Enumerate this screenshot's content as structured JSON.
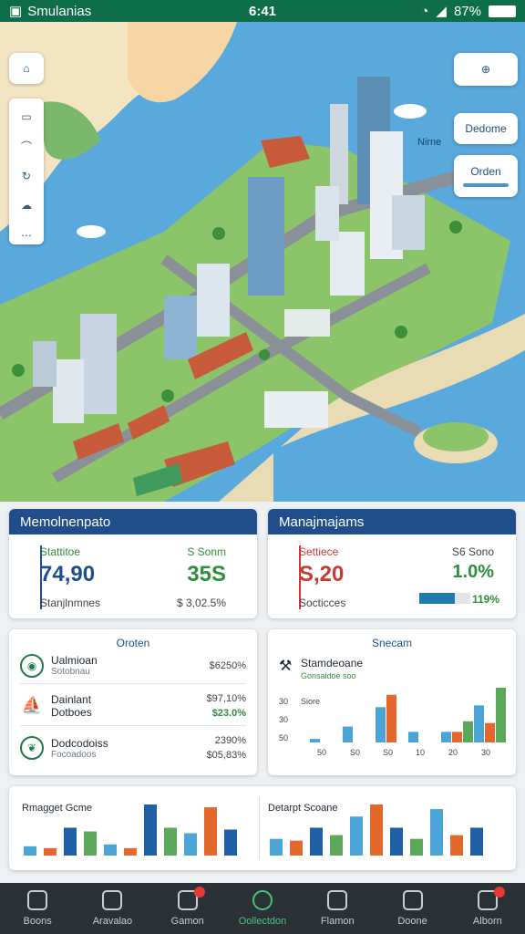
{
  "status_bar": {
    "app_name": "Smulanias",
    "time": "6:41",
    "battery": "87%"
  },
  "map": {
    "controls": {
      "compass": "compass",
      "doneme_label": "Dedome",
      "zoom_label": "Orden"
    },
    "side_label": "Nirne",
    "toolbar_items": [
      "layers-icon",
      "route-icon",
      "refresh-icon",
      "cloud-icon",
      "more-icon"
    ]
  },
  "panel_left": {
    "title": "Memolnenpato",
    "stat_label": "Stattitoe",
    "stat_value": "74,90",
    "right_label": "S Sonm",
    "right_value": "35S",
    "footer_label": "Stanjlnmnes",
    "footer_value": "$ 3,02.5%"
  },
  "panel_right": {
    "title": "Manajmajams",
    "stat_label": "Settiece",
    "stat_value": "S,20",
    "right_label": "S6 Sono",
    "right_value": "1.0%",
    "footer_label": "Socticces",
    "footer_value": "119%",
    "progress": 0.7
  },
  "list_panel": {
    "title": "Oroten",
    "rows": [
      {
        "name": "Ualmioan",
        "sub": "Sotobnau",
        "v1": "$6250%",
        "v2": ""
      },
      {
        "name": "Dainlant\nDotboes",
        "sub": "",
        "v1": "$97,10%",
        "v2": "$23.0%"
      },
      {
        "name": "Dodcodoiss",
        "sub": "Focoadoos",
        "v1": "2390%",
        "v2": "$05,83%"
      }
    ]
  },
  "chart_panel": {
    "title": "Snecam",
    "legend_title": "Stamdeoane",
    "legend_sub": "Gonsaidoe soo",
    "legend_name": "Siore",
    "chart_data": {
      "type": "bar",
      "categories": [
        "50",
        "S0",
        "S0",
        "10",
        "20",
        "30"
      ],
      "series": [
        {
          "name": "",
          "values": [
            2,
            9,
            20,
            6,
            6,
            21
          ]
        },
        {
          "name": "",
          "values": [
            0,
            0,
            27,
            0,
            6,
            11
          ]
        },
        {
          "name": "",
          "values": [
            0,
            0,
            0,
            0,
            12,
            31
          ]
        }
      ],
      "ylabel_ticks": [
        "30",
        "30",
        "50"
      ],
      "colors": [
        "#4aa5d6",
        "#e2682e",
        "#5ba85a"
      ]
    }
  },
  "bottom_panel": {
    "left_title": "Rmagget Gcme",
    "right_title": "Detarpt Scoane",
    "left_chart": {
      "type": "bar",
      "values": [
        10,
        8,
        30,
        26,
        12,
        8,
        55,
        30,
        24,
        52,
        28
      ]
    },
    "right_chart": {
      "type": "bar",
      "values": [
        18,
        16,
        30,
        22,
        42,
        55,
        30,
        18,
        50,
        22,
        30
      ]
    }
  },
  "nav": [
    {
      "label": "Boons",
      "badge": false
    },
    {
      "label": "Aravalao",
      "badge": false
    },
    {
      "label": "Gamon",
      "badge": true
    },
    {
      "label": "Oollectdon",
      "badge": false
    },
    {
      "label": "Flamon",
      "badge": false
    },
    {
      "label": "Doone",
      "badge": false
    },
    {
      "label": "Alborn",
      "badge": true
    }
  ],
  "colors": {
    "primary": "#1f4e8a",
    "accent": "#47c37a",
    "status": "#0f6e4a"
  }
}
